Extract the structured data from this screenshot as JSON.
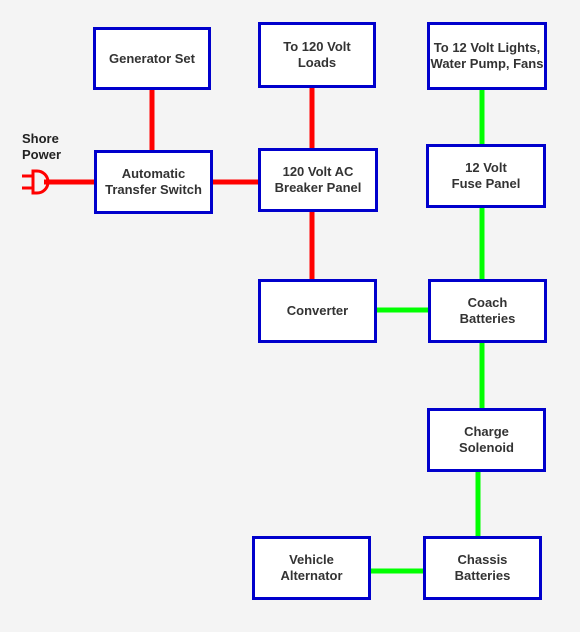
{
  "colors": {
    "ac_line": "#ff0000",
    "dc_line": "#00ff00",
    "box_border": "#0000cc",
    "background": "#f4f4f4"
  },
  "shore_power": {
    "label": "Shore\nPower",
    "icon": "plug-icon"
  },
  "nodes": {
    "generator": "Generator Set",
    "loads120": "To 120 Volt\nLoads",
    "loads12": "To 12 Volt Lights,\nWater Pump, Fans",
    "ats": "Automatic\nTransfer Switch",
    "breaker": "120 Volt AC\nBreaker Panel",
    "fuse": "12 Volt\nFuse Panel",
    "converter": "Converter",
    "coach": "Coach\nBatteries",
    "solenoid": "Charge\nSolenoid",
    "alternator": "Vehicle\nAlternator",
    "chassis": "Chassis\nBatteries"
  },
  "edges": [
    {
      "from": "shore_power",
      "to": "ats",
      "type": "ac"
    },
    {
      "from": "generator",
      "to": "ats",
      "type": "ac"
    },
    {
      "from": "ats",
      "to": "breaker",
      "type": "ac"
    },
    {
      "from": "breaker",
      "to": "loads120",
      "type": "ac"
    },
    {
      "from": "breaker",
      "to": "converter",
      "type": "ac"
    },
    {
      "from": "converter",
      "to": "coach",
      "type": "dc"
    },
    {
      "from": "coach",
      "to": "fuse",
      "type": "dc"
    },
    {
      "from": "fuse",
      "to": "loads12",
      "type": "dc"
    },
    {
      "from": "coach",
      "to": "solenoid",
      "type": "dc"
    },
    {
      "from": "solenoid",
      "to": "chassis",
      "type": "dc"
    },
    {
      "from": "alternator",
      "to": "chassis",
      "type": "dc"
    }
  ]
}
